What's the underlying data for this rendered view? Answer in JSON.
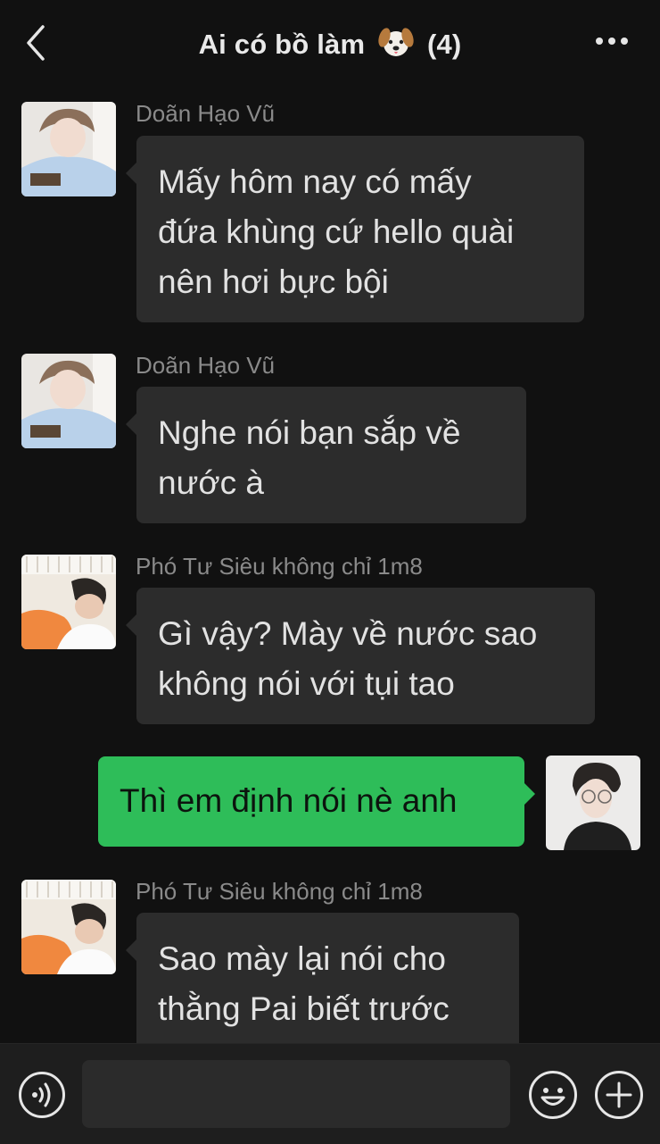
{
  "header": {
    "title_prefix": "Ai có bồ làm",
    "title_emoji": "dog-face-icon",
    "member_count": "(4)"
  },
  "messages": [
    {
      "sender": "Doãn Hạo Vũ",
      "lines": [
        "Mấy hôm nay có mấy",
        "đứa khùng cứ hello quài",
        "nên hơi bực bội"
      ],
      "avatar": "avatar-boy-reading",
      "mine": false
    },
    {
      "sender": "Doãn Hạo Vũ",
      "lines": [
        "Nghe nói bạn sắp về",
        "nước à"
      ],
      "avatar": "avatar-boy-reading",
      "mine": false
    },
    {
      "sender": "Phó Tư Siêu không chỉ 1m8",
      "lines": [
        "Gì vậy? Mày về nước sao",
        "không nói với tụi tao"
      ],
      "avatar": "avatar-boy-sleeping",
      "mine": false
    },
    {
      "sender": "",
      "lines": [
        "Thì em định nói nè anh"
      ],
      "avatar": "avatar-boy-glasses",
      "mine": true
    },
    {
      "sender": "Phó Tư Siêu không chỉ 1m8",
      "lines": [
        "Sao mày lại nói cho",
        "thằng Pai biết trước"
      ],
      "avatar": "avatar-boy-sleeping",
      "mine": false
    }
  ],
  "bottom_bar": {
    "input_value": "",
    "icons": [
      "voice-icon",
      "emoji-icon",
      "plus-icon"
    ]
  },
  "colors": {
    "background": "#111111",
    "bubble_other": "#2c2c2c",
    "bubble_mine": "#2ebd59",
    "sender_name": "#8a8a8a"
  }
}
